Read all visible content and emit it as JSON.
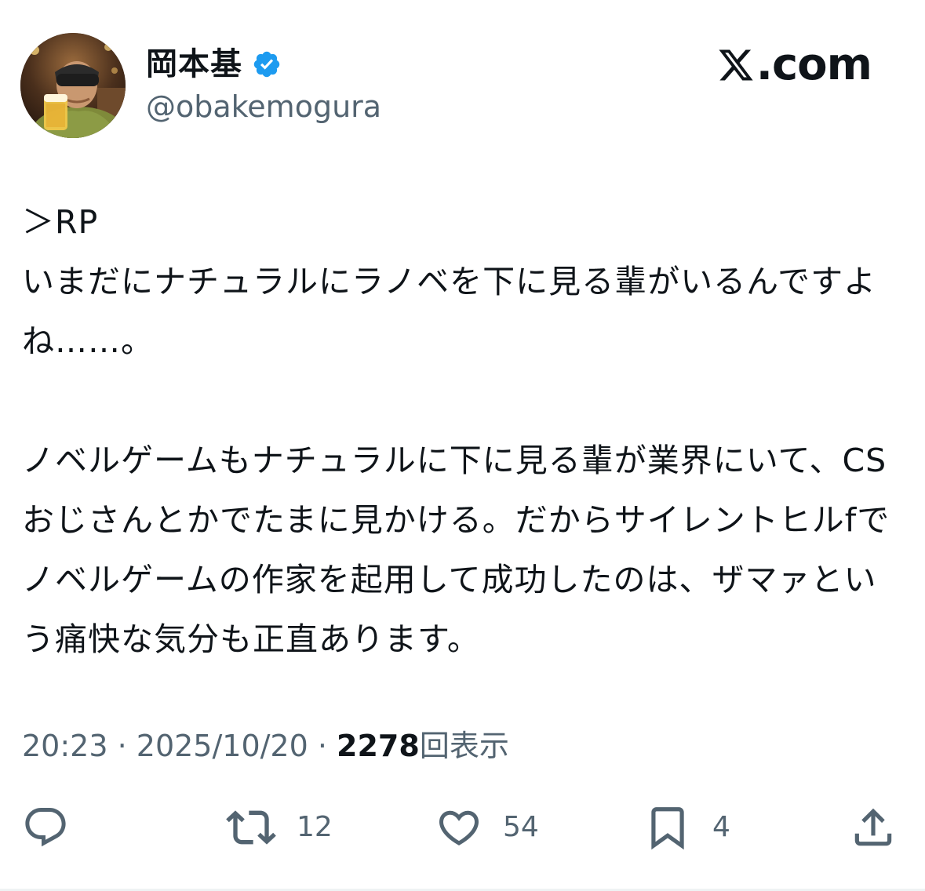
{
  "author": {
    "display_name": "岡本基",
    "handle": "@obakemogura",
    "verified": true
  },
  "brand": {
    "label": "X.com",
    "suffix": ".com"
  },
  "tweet": {
    "paragraphs": [
      "＞RP\nいまだにナチュラルにラノベを下に見る輩がいるんですよね……。",
      "ノベルゲームもナチュラルに下に見る輩が業界にいて、CSおじさんとかでたまに見かける。だからサイレントヒルfでノベルゲームの作家を起用して成功したのは、ザマァという痛快な気分も正直あります。"
    ]
  },
  "meta": {
    "time": "20:23",
    "separator": " · ",
    "date": "2025/10/20",
    "views_count": "2278",
    "views_label": "回表示"
  },
  "actions": {
    "reply": {
      "icon": "reply-icon",
      "count": ""
    },
    "repost": {
      "icon": "repost-icon",
      "count": "12"
    },
    "like": {
      "icon": "heart-icon",
      "count": "54"
    },
    "bookmark": {
      "icon": "bookmark-icon",
      "count": "4"
    },
    "share": {
      "icon": "share-icon",
      "count": ""
    }
  },
  "colors": {
    "text_primary": "#0f1419",
    "text_secondary": "#536471",
    "verified_blue": "#1d9bf0"
  }
}
